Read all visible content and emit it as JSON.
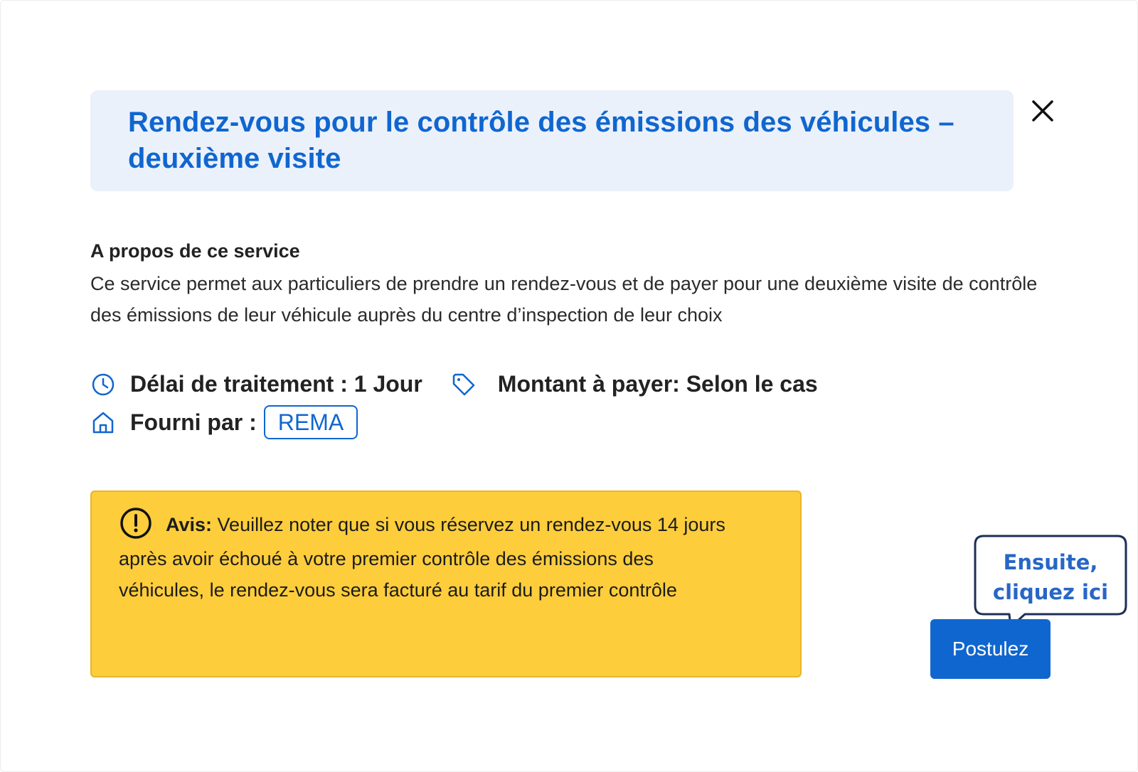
{
  "modal": {
    "title": "Rendez-vous pour le contrôle des émissions des véhicules – deuxième visite",
    "close_icon": "close-icon"
  },
  "about": {
    "heading": "A propos de ce service",
    "description": "Ce service permet aux particuliers de prendre un rendez-vous et de payer pour une deuxième visite de contrôle des émissions de leur véhicule auprès du centre d’inspection de leur choix"
  },
  "meta": {
    "delay": "Délai de traitement : 1 Jour",
    "delay_icon": "clock-icon",
    "price": "Montant à payer: Selon le cas",
    "price_icon": "tag-icon",
    "provider_label": "Fourni par :",
    "provider_icon": "home-icon",
    "provider_value": "REMA"
  },
  "notice": {
    "icon": "exclamation-circle-icon",
    "title": "Avis:",
    "text": " Veuillez noter que si vous réservez un rendez-vous 14 jours après avoir échoué à votre premier contrôle des émissions des véhicules, le rendez-vous sera facturé au tarif du premier contrôle"
  },
  "actions": {
    "apply_label": "Postulez"
  },
  "callout": {
    "line1": "Ensuite,",
    "line2": "cliquez ici"
  },
  "colors": {
    "primary": "#1066cf",
    "banner_bg": "#ebf1fb",
    "notice_bg": "#fdcd3c",
    "callout_text": "#2866c6"
  }
}
